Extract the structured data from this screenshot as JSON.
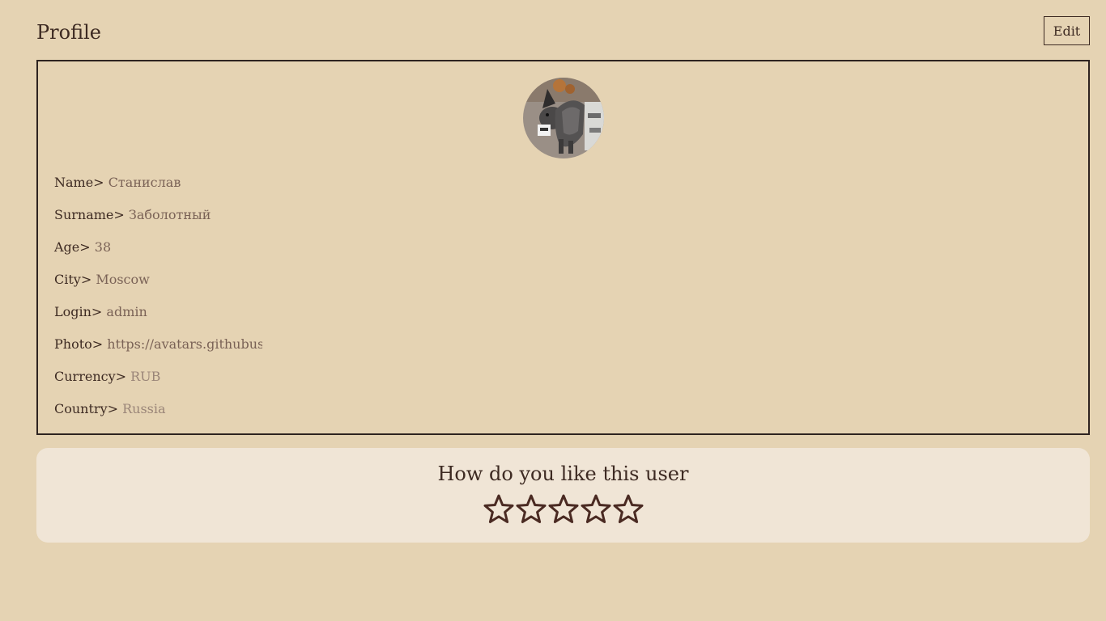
{
  "header": {
    "title": "Profile",
    "edit_label": "Edit"
  },
  "profile": {
    "avatar_icon": "dog-photo",
    "fields": [
      {
        "label": "Name>",
        "value": "Станислав"
      },
      {
        "label": "Surname>",
        "value": "Заболотный"
      },
      {
        "label": "Age>",
        "value": "38"
      },
      {
        "label": "City>",
        "value": "Moscow"
      },
      {
        "label": "Login>",
        "value": "admin"
      },
      {
        "label": "Photo>",
        "value": "https://avatars.githubusercontent.com"
      },
      {
        "label": "Currency>",
        "value": "RUB"
      },
      {
        "label": "Country>",
        "value": "Russia"
      }
    ]
  },
  "rating": {
    "question": "How do you like this user",
    "max_stars": 5,
    "value": 0,
    "star_icon": "star-outline-icon"
  },
  "colors": {
    "background": "#e5d3b3",
    "panel": "#f0e5d6",
    "text": "#3d2a22",
    "muted": "#7a6256"
  }
}
